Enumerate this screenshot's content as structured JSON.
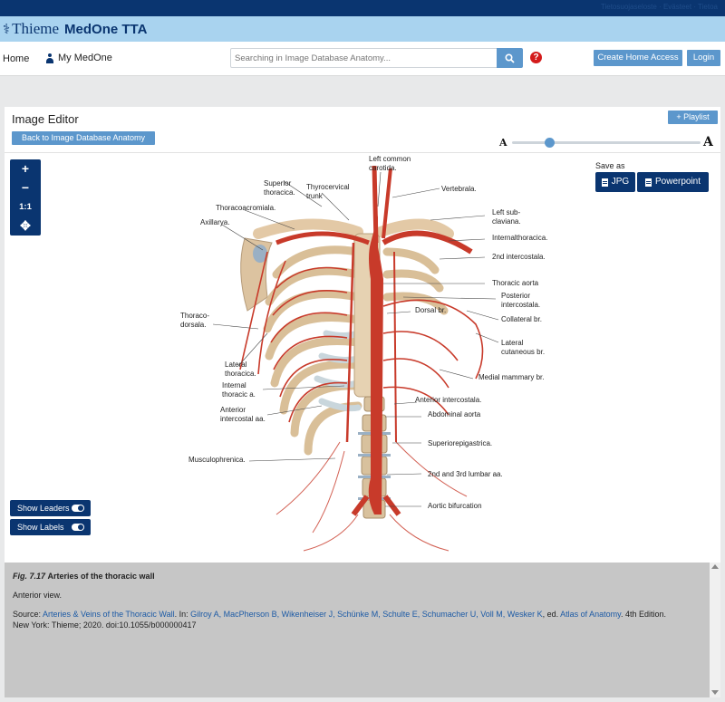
{
  "header": {
    "top_links": "Tietosuojaseloste · Evästeet · Tietoa",
    "brand_name": "Thieme",
    "product_name": "MedOne TTA"
  },
  "nav": {
    "home": "Home",
    "my_medone": "My MedOne",
    "search_placeholder": "Searching in Image Database Anatomy...",
    "create_home_access": "Create Home Access",
    "login": "Login"
  },
  "editor": {
    "title": "Image Editor",
    "back_button": "Back to Image Database Anatomy",
    "playlist_button": "+ Playlist",
    "font_small": "A",
    "font_large": "A",
    "font_size_level": 0.2,
    "zoom_in": "+",
    "zoom_out": "−",
    "zoom_reset": "1:1",
    "pan": "✥",
    "save_as": "Save as",
    "save_jpg": "JPG",
    "save_ppt": "Powerpoint",
    "show_leaders": "Show Leaders",
    "show_labels": "Show Labels",
    "show_leaders_on": true,
    "show_labels_on": true
  },
  "figure_labels": {
    "superior_thoracica": "Superior thoracica.",
    "thyrocervical": "Thyrocervical trunk",
    "left_common_carotid": "Left common carotida.",
    "vertebral": "Vertebrala.",
    "thoracoacromial": "Thoracoacromiala.",
    "axillary": "Axillarya.",
    "left_subclavian": "Left sub-claviana.",
    "internal_thoracic": "Internalthoracica.",
    "intercostal_2nd": "2nd intercostala.",
    "thoracic_aorta": "Thoracic aorta",
    "posterior_intercostal": "Posterior intercostala.",
    "thoracodorsal": "Thoraco-dorsala.",
    "dorsal_br": "Dorsal br.",
    "collateral_br": "Collateral br.",
    "lateral_cutaneous": "Lateral cutaneous br.",
    "lateral_thoracic": "Lateral thoracica.",
    "medial_mammary": "Medial mammary br.",
    "internal_thoracic_a": "Internal thoracic a.",
    "anterior_intercostal": "Anterior intercostala.",
    "anterior_intercostal_aa": "Anterior intercostal aa.",
    "abdominal_aorta": "Abdominal aorta",
    "superior_epigastric": "Superiorepigastrica.",
    "musculophrenic": "Musculophrenica.",
    "lumbar": "2nd and 3rd lumbar aa.",
    "aortic_bifurcation": "Aortic bifurcation"
  },
  "caption": {
    "fig_no": "Fig. 7.17",
    "fig_title": "Arteries of the thoracic wall",
    "view": "Anterior view.",
    "source_prefix": "Source: ",
    "source_link": "Arteries & Veins of the Thoracic Wall",
    "source_in": ". In: ",
    "authors": "Gilroy A, MacPherson B, Wikenheiser J, Schünke M, Schulte E, Schumacher U, Voll M, Wesker K",
    "ed": ", ed. ",
    "book": "Atlas of Anatomy",
    "edition_rest": ". 4th Edition.",
    "publisher": "New York: Thieme; 2020. doi:10.1055/b000000417"
  },
  "colors": {
    "navy": "#0a3570",
    "light_blue": "#a9d3ef",
    "button_blue": "#5c97cc",
    "help_red": "#d41b1b",
    "artery_red": "#c83a2a"
  }
}
